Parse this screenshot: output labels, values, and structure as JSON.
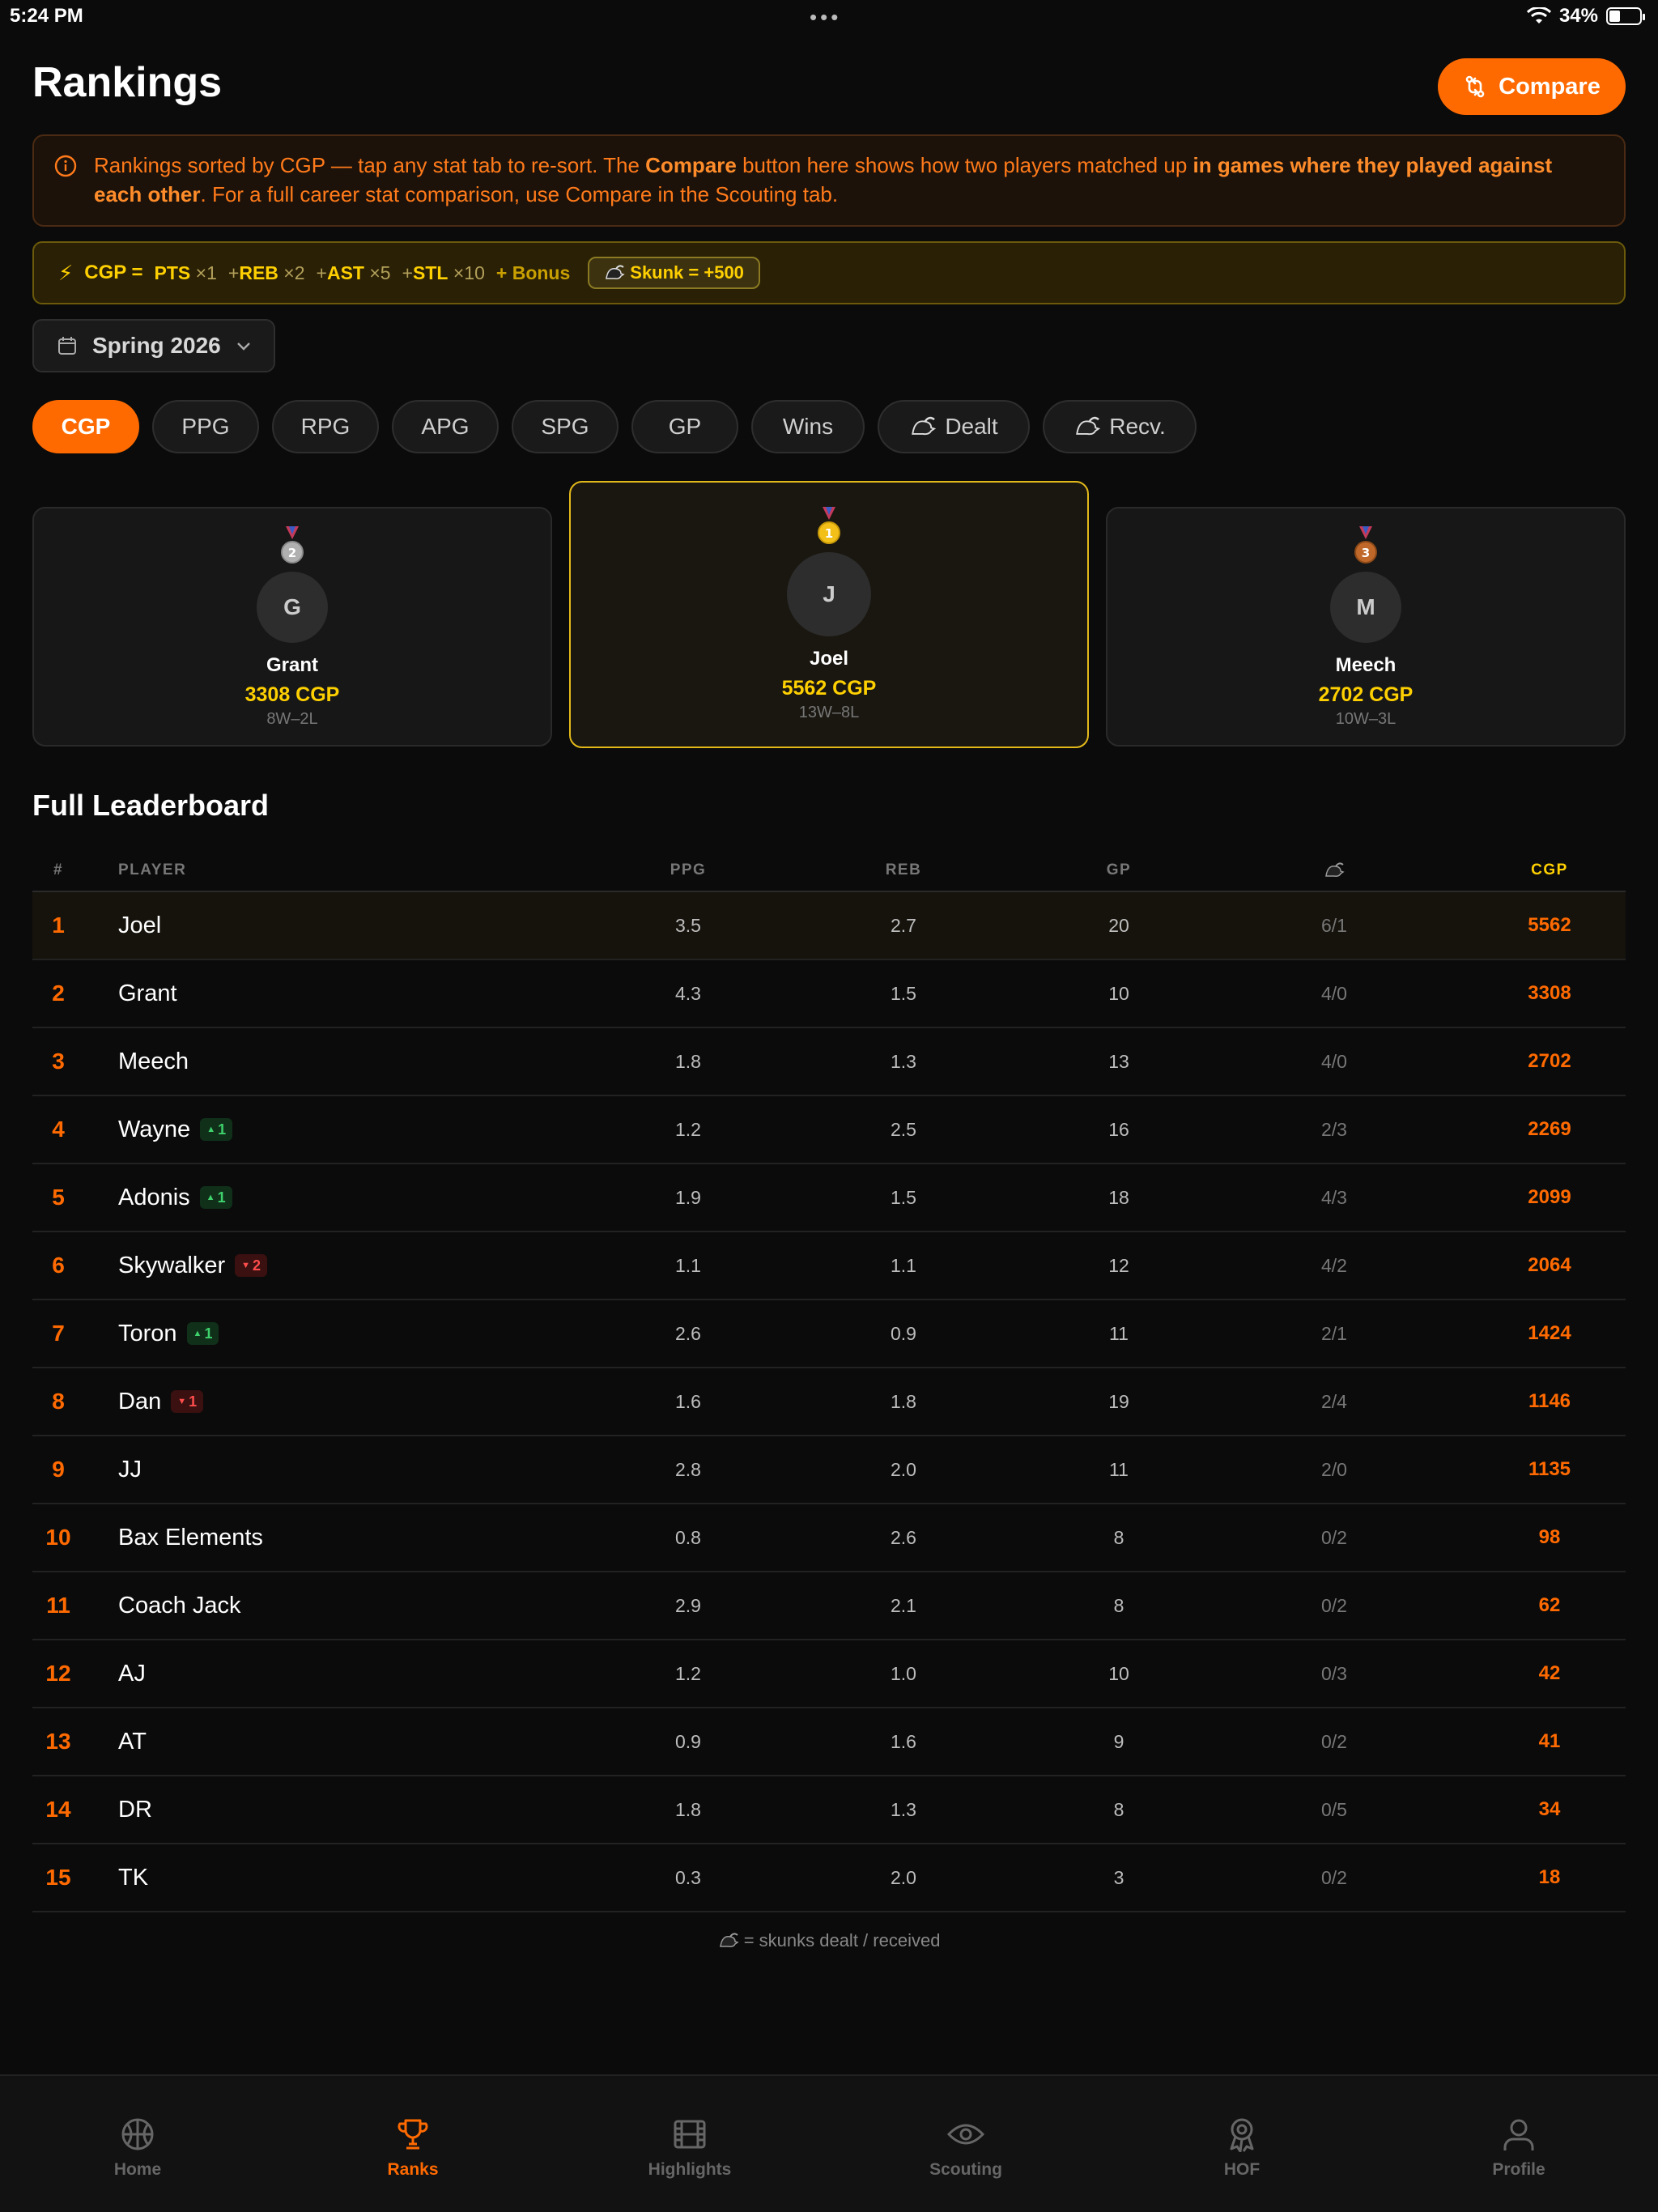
{
  "status": {
    "time": "5:24 PM",
    "battery": "34%",
    "battery_level": 0.34
  },
  "header": {
    "title": "Rankings",
    "compare_label": "Compare"
  },
  "info": {
    "t1": "Rankings sorted by CGP — tap any stat tab to re-sort. The ",
    "b1": "Compare",
    "t2": " button here shows how two players matched up ",
    "b2": "in games where they played against each other",
    "t3": ". For a full career stat comparison, use Compare in the Scouting tab."
  },
  "formula": {
    "lead": "CGP =",
    "terms": [
      {
        "label": "PTS",
        "mult": "×1"
      },
      {
        "label": "REB",
        "mult": "×2"
      },
      {
        "label": "AST",
        "mult": "×5"
      },
      {
        "label": "STL",
        "mult": "×10"
      }
    ],
    "bonus": "Bonus",
    "skunk": "Skunk = +500"
  },
  "season": {
    "label": "Spring 2026"
  },
  "tabs": [
    "CGP",
    "PPG",
    "RPG",
    "APG",
    "SPG",
    "GP",
    "Wins",
    "Dealt",
    "Recv."
  ],
  "podium": [
    {
      "place": "2",
      "initial": "G",
      "name": "Grant",
      "cgp": "3308 CGP",
      "record": "8W–2L"
    },
    {
      "place": "1",
      "initial": "J",
      "name": "Joel",
      "cgp": "5562 CGP",
      "record": "13W–8L"
    },
    {
      "place": "3",
      "initial": "M",
      "name": "Meech",
      "cgp": "2702 CGP",
      "record": "10W–3L"
    }
  ],
  "leaderboard": {
    "title": "Full Leaderboard",
    "headers": {
      "rank": "#",
      "player": "PLAYER",
      "ppg": "PPG",
      "reb": "REB",
      "gp": "GP",
      "cgp": "CGP"
    },
    "rows": [
      {
        "rank": "1",
        "player": "Joel",
        "badge": null,
        "ppg": "3.5",
        "reb": "2.7",
        "gp": "20",
        "skunks": "6/1",
        "cgp": "5562"
      },
      {
        "rank": "2",
        "player": "Grant",
        "badge": null,
        "ppg": "4.3",
        "reb": "1.5",
        "gp": "10",
        "skunks": "4/0",
        "cgp": "3308"
      },
      {
        "rank": "3",
        "player": "Meech",
        "badge": null,
        "ppg": "1.8",
        "reb": "1.3",
        "gp": "13",
        "skunks": "4/0",
        "cgp": "2702"
      },
      {
        "rank": "4",
        "player": "Wayne",
        "badge": {
          "dir": "up",
          "value": "1"
        },
        "ppg": "1.2",
        "reb": "2.5",
        "gp": "16",
        "skunks": "2/3",
        "cgp": "2269"
      },
      {
        "rank": "5",
        "player": "Adonis",
        "badge": {
          "dir": "up",
          "value": "1"
        },
        "ppg": "1.9",
        "reb": "1.5",
        "gp": "18",
        "skunks": "4/3",
        "cgp": "2099"
      },
      {
        "rank": "6",
        "player": "Skywalker",
        "badge": {
          "dir": "down",
          "value": "2"
        },
        "ppg": "1.1",
        "reb": "1.1",
        "gp": "12",
        "skunks": "4/2",
        "cgp": "2064"
      },
      {
        "rank": "7",
        "player": "Toron",
        "badge": {
          "dir": "up",
          "value": "1"
        },
        "ppg": "2.6",
        "reb": "0.9",
        "gp": "11",
        "skunks": "2/1",
        "cgp": "1424"
      },
      {
        "rank": "8",
        "player": "Dan",
        "badge": {
          "dir": "down",
          "value": "1"
        },
        "ppg": "1.6",
        "reb": "1.8",
        "gp": "19",
        "skunks": "2/4",
        "cgp": "1146"
      },
      {
        "rank": "9",
        "player": "JJ",
        "badge": null,
        "ppg": "2.8",
        "reb": "2.0",
        "gp": "11",
        "skunks": "2/0",
        "cgp": "1135"
      },
      {
        "rank": "10",
        "player": "Bax Elements",
        "badge": null,
        "ppg": "0.8",
        "reb": "2.6",
        "gp": "8",
        "skunks": "0/2",
        "cgp": "98"
      },
      {
        "rank": "11",
        "player": "Coach Jack",
        "badge": null,
        "ppg": "2.9",
        "reb": "2.1",
        "gp": "8",
        "skunks": "0/2",
        "cgp": "62"
      },
      {
        "rank": "12",
        "player": "AJ",
        "badge": null,
        "ppg": "1.2",
        "reb": "1.0",
        "gp": "10",
        "skunks": "0/3",
        "cgp": "42"
      },
      {
        "rank": "13",
        "player": "AT",
        "badge": null,
        "ppg": "0.9",
        "reb": "1.6",
        "gp": "9",
        "skunks": "0/2",
        "cgp": "41"
      },
      {
        "rank": "14",
        "player": "DR",
        "badge": null,
        "ppg": "1.8",
        "reb": "1.3",
        "gp": "8",
        "skunks": "0/5",
        "cgp": "34"
      },
      {
        "rank": "15",
        "player": "TK",
        "badge": null,
        "ppg": "0.3",
        "reb": "2.0",
        "gp": "3",
        "skunks": "0/2",
        "cgp": "18"
      }
    ],
    "footnote": "= skunks dealt / received"
  },
  "nav": [
    "Home",
    "Ranks",
    "Highlights",
    "Scouting",
    "HOF",
    "Profile"
  ],
  "colors": {
    "accent": "#ff6a00",
    "gold": "#ffd000",
    "up": "#3fd16b",
    "down": "#ff4d4d"
  }
}
